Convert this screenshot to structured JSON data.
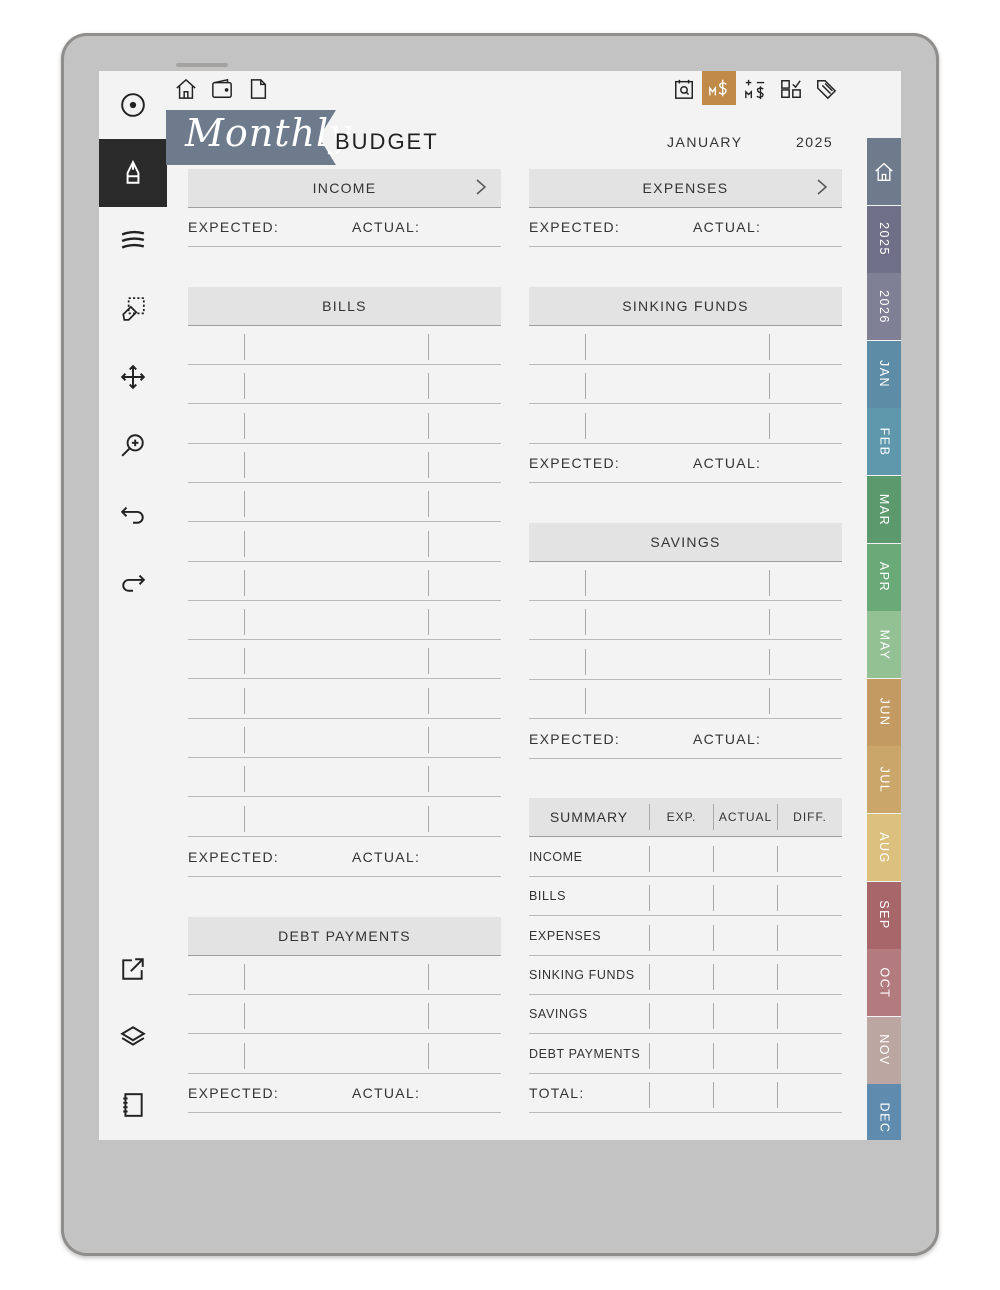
{
  "page": {
    "banner_script": "Monthly",
    "title": "BUDGET",
    "month": "JANUARY",
    "year": "2025"
  },
  "labels": {
    "expected": "EXPECTED:",
    "actual": "ACTUAL:"
  },
  "sections": {
    "income": "INCOME",
    "expenses": "EXPENSES",
    "bills": "BILLS",
    "sinking_funds": "SINKING FUNDS",
    "savings": "SAVINGS",
    "debt_payments": "DEBT PAYMENTS"
  },
  "summary": {
    "headers": [
      "SUMMARY",
      "EXP.",
      "ACTUAL",
      "DIFF."
    ],
    "rows": [
      "INCOME",
      "BILLS",
      "EXPENSES",
      "SINKING FUNDS",
      "SAVINGS",
      "DEBT PAYMENTS"
    ],
    "total": "TOTAL:"
  },
  "tabs": [
    {
      "label": "home-icon",
      "color": "#6e7b8c"
    },
    {
      "label": "2025",
      "color": "#6f6f87"
    },
    {
      "label": "2026",
      "color": "#7f7f95"
    },
    {
      "label": "JAN",
      "color": "#5d8ca6"
    },
    {
      "label": "FEB",
      "color": "#5f97ad"
    },
    {
      "label": "MAR",
      "color": "#5c9a6e"
    },
    {
      "label": "APR",
      "color": "#6aaa78"
    },
    {
      "label": "MAY",
      "color": "#93c194"
    },
    {
      "label": "JUN",
      "color": "#c39a62"
    },
    {
      "label": "JUL",
      "color": "#cba66a"
    },
    {
      "label": "AUG",
      "color": "#dcc07e"
    },
    {
      "label": "SEP",
      "color": "#a7666a"
    },
    {
      "label": "OCT",
      "color": "#b37b7e"
    },
    {
      "label": "NOV",
      "color": "#bba6a2"
    },
    {
      "label": "DEC",
      "color": "#5f8cae"
    }
  ],
  "colors": {
    "accent_orange": "#c08a48",
    "banner": "#6e7b8c",
    "active_tool": "#2a2a2a"
  }
}
